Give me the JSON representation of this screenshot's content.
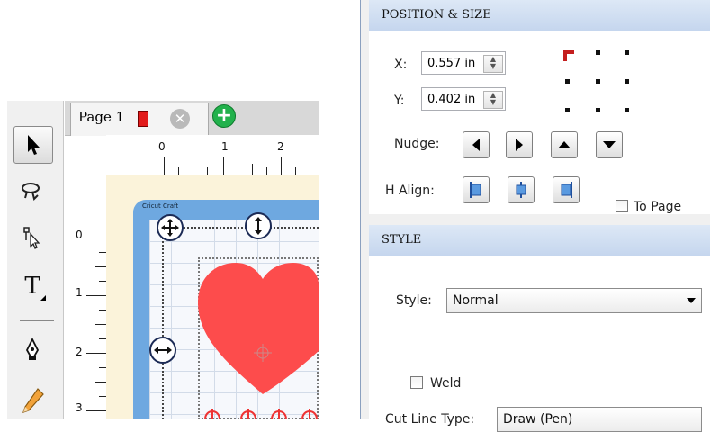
{
  "canvas": {
    "page_tab": {
      "label": "Page 1",
      "page_color": "#e21b1b"
    },
    "ruler_h_labels": [
      "0",
      "1",
      "2"
    ],
    "ruler_v_labels": [
      "0",
      "1",
      "2",
      "3"
    ],
    "mat_label": "Cricut Craft",
    "shape_color": "#fd4c4c"
  },
  "toolbar": {
    "tools": [
      {
        "icon": "arrow-pointer-icon",
        "active": true
      },
      {
        "icon": "lasso-icon",
        "active": false
      },
      {
        "icon": "node-edit-icon",
        "active": false
      },
      {
        "icon": "text-tool-icon",
        "label": "T",
        "active": false
      },
      {
        "icon": "pen-tool-icon",
        "active": false
      },
      {
        "icon": "pencil-icon",
        "active": false
      }
    ]
  },
  "position_size": {
    "header": "POSITION & SIZE",
    "x_label": "X:",
    "x_value": "0.557 in",
    "y_label": "Y:",
    "y_value": "0.402 in",
    "nudge_label": "Nudge:",
    "halign_label": "H Align:",
    "to_page_label": "To Page",
    "anchor_selected": "top-left"
  },
  "style": {
    "header": "STYLE",
    "style_label": "Style:",
    "style_value": "Normal",
    "weld_label": "Weld",
    "cut_line_type_label": "Cut Line Type:",
    "cut_line_type_value": "Draw (Pen)"
  }
}
